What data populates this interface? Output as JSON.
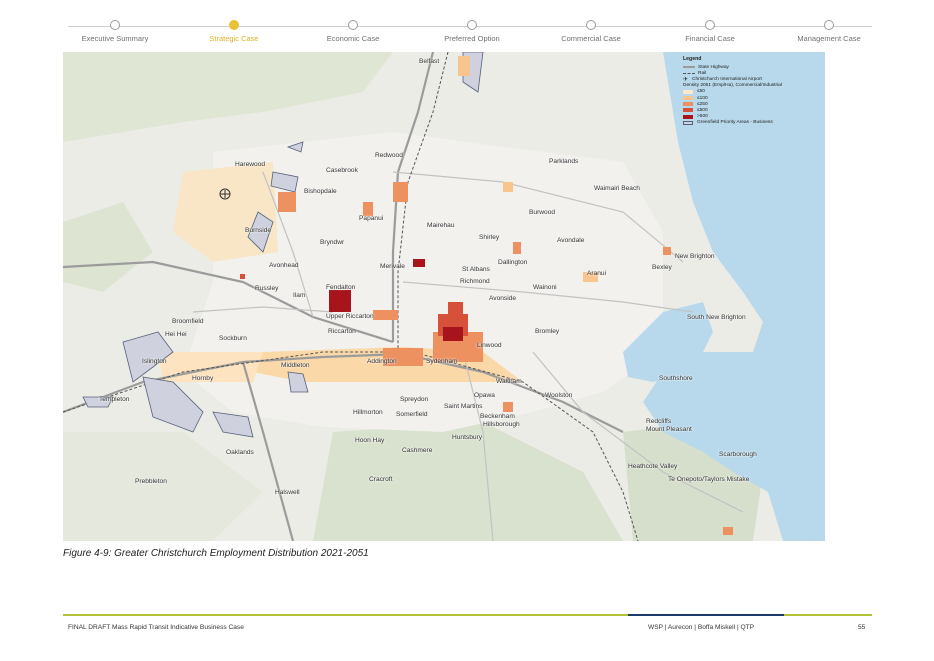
{
  "nav": {
    "steps": [
      {
        "label": "Executive Summary",
        "active": false
      },
      {
        "label": "Strategic Case",
        "active": true
      },
      {
        "label": "Economic Case",
        "active": false
      },
      {
        "label": "Preferred Option",
        "active": false
      },
      {
        "label": "Commercial Case",
        "active": false
      },
      {
        "label": "Financial Case",
        "active": false
      },
      {
        "label": "Management Case",
        "active": false
      }
    ]
  },
  "map": {
    "legend": {
      "title": "Legend",
      "state_highway": "State Highway",
      "rail": "Rail",
      "airport": "Christchurch International Airport",
      "density_title": "Density 2051 (Emp/Ha), Commercial/Industrial",
      "classes": [
        {
          "label": "≤50",
          "color": "#fde9c9"
        },
        {
          "label": "≤100",
          "color": "#f8c58f"
        },
        {
          "label": "≤250",
          "color": "#ee9160"
        },
        {
          "label": "≤500",
          "color": "#d7503a"
        },
        {
          "label": ">500",
          "color": "#a8141c"
        }
      ],
      "greenfield": "Greenfield Priority Areas - Business"
    },
    "places": [
      "Belfast",
      "Redwood",
      "Casebrook",
      "Harewood",
      "Bishopdale",
      "Parklands",
      "Waimairi Beach",
      "Burwood",
      "Papanui",
      "Mairehau",
      "Burnside",
      "Shirley",
      "Avondale",
      "Bryndwr",
      "Dallington",
      "New Brighton",
      "Avonhead",
      "Merivale",
      "St Albans",
      "Aranui",
      "Bexley",
      "Richmond",
      "Russley",
      "Ilam",
      "Fendalton",
      "Wainoni",
      "Avonside",
      "Upper Riccarton",
      "Broomfield",
      "South New Brighton",
      "Hei Hei",
      "Sockburn",
      "Riccarton",
      "Linwood",
      "Bromley",
      "Islington",
      "Middleton",
      "Addington",
      "Hornby",
      "Sydenham",
      "Southshore",
      "Waltham",
      "Templeton",
      "Spreydon",
      "Woolston",
      "Opawa",
      "Saint Martins",
      "Hillmorton",
      "Somerfield",
      "Beckenham",
      "Hillsborough",
      "Redcliffs",
      "Mount Pleasant",
      "Hoon Hay",
      "Huntsbury",
      "Oaklands",
      "Cashmere",
      "Scarborough",
      "Heathcote Valley",
      "Cracroft",
      "Te Onepoto/Taylors Mistake",
      "Prebbleton",
      "Halswell"
    ]
  },
  "caption": "Figure 4-9: Greater Christchurch Employment Distribution 2021-2051",
  "footer": {
    "left": "FINAL DRAFT Mass Rapid Transit Indicative Business Case",
    "right": "WSP | Aurecon | Boffa Miskell | QTP",
    "page": "55"
  }
}
